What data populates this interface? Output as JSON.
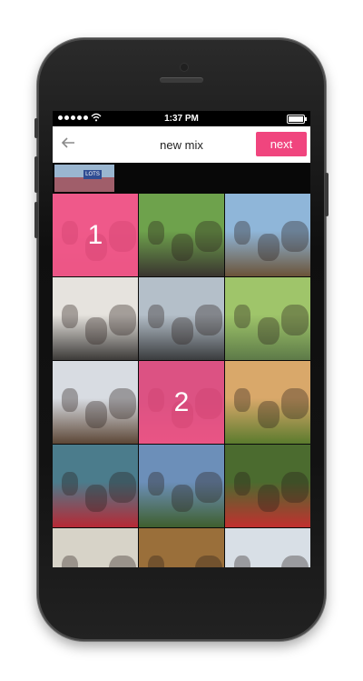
{
  "status_bar": {
    "time": "1:37 PM",
    "wifi_icon": "wifi-icon",
    "battery_icon": "battery-icon"
  },
  "header": {
    "back_icon": "arrow-left-icon",
    "title": "new mix",
    "next_label": "next"
  },
  "selected_strip": {
    "thumbnail_text": "LOTS"
  },
  "grid": {
    "tiles": [
      {
        "row": 0,
        "col": 0,
        "selected": true,
        "order": "1",
        "colors": [
          "#e7b3bf",
          "#d89aa7"
        ]
      },
      {
        "row": 0,
        "col": 1,
        "selected": false,
        "colors": [
          "#6ea24c",
          "#3a3530"
        ]
      },
      {
        "row": 0,
        "col": 2,
        "selected": false,
        "colors": [
          "#8fb6d9",
          "#6b5338"
        ]
      },
      {
        "row": 1,
        "col": 0,
        "selected": false,
        "colors": [
          "#e6e3de",
          "#3c3a38"
        ]
      },
      {
        "row": 1,
        "col": 1,
        "selected": false,
        "colors": [
          "#b4bfc9",
          "#3a3c3e"
        ]
      },
      {
        "row": 1,
        "col": 2,
        "selected": false,
        "colors": [
          "#9fc56a",
          "#5d7a48"
        ]
      },
      {
        "row": 2,
        "col": 0,
        "selected": false,
        "colors": [
          "#d8dce2",
          "#5c4636"
        ]
      },
      {
        "row": 2,
        "col": 1,
        "selected": true,
        "order": "2",
        "colors": [
          "#7f8a9a",
          "#c99aa5"
        ]
      },
      {
        "row": 2,
        "col": 2,
        "selected": false,
        "colors": [
          "#d9a86a",
          "#5b7b2e"
        ]
      },
      {
        "row": 3,
        "col": 0,
        "selected": false,
        "colors": [
          "#4b7c8c",
          "#b72935"
        ]
      },
      {
        "row": 3,
        "col": 1,
        "selected": false,
        "colors": [
          "#6c8fb9",
          "#3f5f2e"
        ]
      },
      {
        "row": 3,
        "col": 2,
        "selected": false,
        "colors": [
          "#4b6b2f",
          "#c2302f"
        ]
      },
      {
        "row": 4,
        "col": 0,
        "selected": false,
        "colors": [
          "#d7d3c8",
          "#e9e6dd"
        ]
      },
      {
        "row": 4,
        "col": 1,
        "selected": false,
        "colors": [
          "#9a6f3a",
          "#7e5a2d"
        ]
      },
      {
        "row": 4,
        "col": 2,
        "selected": false,
        "colors": [
          "#d8dfe6",
          "#8a6a50"
        ]
      }
    ]
  },
  "colors": {
    "accent": "#f0457e",
    "phone_body": "#141414"
  }
}
